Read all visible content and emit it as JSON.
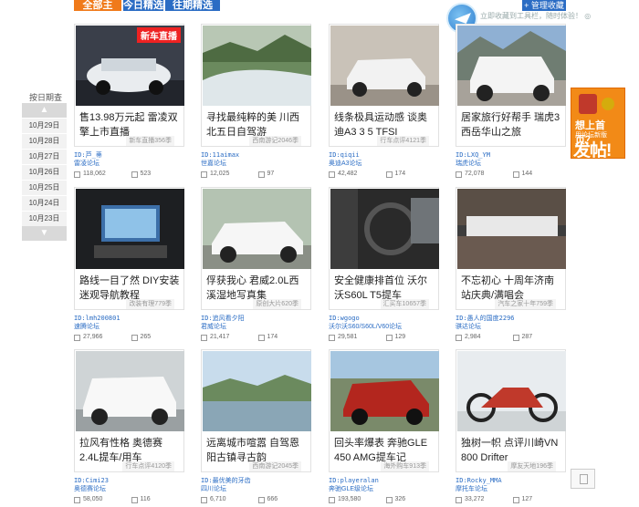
{
  "nav": {
    "tabs": [
      {
        "label": "全部主题",
        "active": true
      },
      {
        "label": "今日精选",
        "active": false
      },
      {
        "label": "往期精选",
        "active": false
      }
    ],
    "collect_label": "+ 管理收藏",
    "faint_text": "立即收藏到工具栏，随时体验！ ◎",
    "accent": "#f07a1a",
    "brand": "#2a6cc4"
  },
  "date_nav": {
    "title": "按日期查看",
    "dates": [
      "10月29日",
      "10月28日",
      "10月27日",
      "10月26日",
      "10月25日",
      "10月24日",
      "10月23日"
    ]
  },
  "cards": [
    {
      "title": "售13.98万元起 雷凌双擎上市直播",
      "meta": "新车直播356季",
      "id": "ID:芦_蒂",
      "forum": "雷凌论坛",
      "views": "118,062",
      "replies": "523",
      "badge": "新车直播",
      "thumb": "white-car-show"
    },
    {
      "title": "寻找最纯粹的美 川西北五日自驾游",
      "meta": "西南游记2046季",
      "id": "ID:11aimax",
      "forum": "世嘉论坛",
      "views": "12,025",
      "replies": "97",
      "badge": "",
      "thumb": "river"
    },
    {
      "title": "线条极具运动感 谈奥迪A3 3 5 TFSI",
      "meta": "行车点评4121季",
      "id": "ID:qiqii",
      "forum": "奥迪A3论坛",
      "views": "42,482",
      "replies": "174",
      "badge": "",
      "thumb": "white-audi"
    },
    {
      "title": "居家旅行好帮手 瑞虎3西岳华山之旅",
      "meta": "",
      "id": "ID:LXQ_YM",
      "forum": "瑞虎论坛",
      "views": "72,078",
      "replies": "144",
      "badge": "",
      "thumb": "white-suv"
    },
    {
      "title": "路线一目了然 DIY安装迷观导航教程",
      "meta": "改装有理779季",
      "id": "ID:lmh200801",
      "forum": "速腾论坛",
      "views": "27,966",
      "replies": "265",
      "badge": "",
      "thumb": "dashboard"
    },
    {
      "title": "俘获我心 君威2.0L西溪湿地写真集",
      "meta": "原创大片620季",
      "id": "ID:追风看夕阳",
      "forum": "君威论坛",
      "views": "21,417",
      "replies": "174",
      "badge": "",
      "thumb": "white-buick"
    },
    {
      "title": "安全健康排首位 沃尔沃S60L T5提车",
      "meta": "汇买车10657季",
      "id": "ID:wgogo",
      "forum": "沃尔沃S60/S60L/V60论坛",
      "views": "29,581",
      "replies": "129",
      "badge": "",
      "thumb": "interior"
    },
    {
      "title": "不忘初心 十周年济南站庆典/满唱会",
      "meta": "汽车之家十年759季",
      "id": "ID:愚人的国度2296",
      "forum": "骐达论坛",
      "views": "2,984",
      "replies": "287",
      "badge": "",
      "thumb": "crowd"
    },
    {
      "title": "拉风有性格 奥德赛2.4L提车/用车",
      "meta": "行车点评4120季",
      "id": "ID:Cimi23",
      "forum": "奥德赛论坛",
      "views": "58,050",
      "replies": "116",
      "badge": "",
      "thumb": "white-van"
    },
    {
      "title": "远离城市喧嚣 自驾恩阳古镇寻古韵",
      "meta": "西南游记2045季",
      "id": "ID:最优美的牙齿",
      "forum": "四川论坛",
      "views": "6,710",
      "replies": "666",
      "badge": "",
      "thumb": "lake"
    },
    {
      "title": "回头率爆表 奔驰GLE 450 AMG提车记",
      "meta": "海外购车913季",
      "id": "ID:playeralan",
      "forum": "奔驰GLE级论坛",
      "views": "193,580",
      "replies": "326",
      "badge": "",
      "thumb": "red-suv"
    },
    {
      "title": "独树一帜 点评川崎VN 800 Drifter",
      "meta": "摩友天地196季",
      "id": "ID:Rocky_MMA",
      "forum": "摩托车论坛",
      "views": "33,272",
      "replies": "127",
      "badge": "",
      "thumb": "motorcycle"
    }
  ],
  "ad": {
    "line1": "想上首页？",
    "line2": "用论坛新版",
    "line3": "发帖!"
  }
}
